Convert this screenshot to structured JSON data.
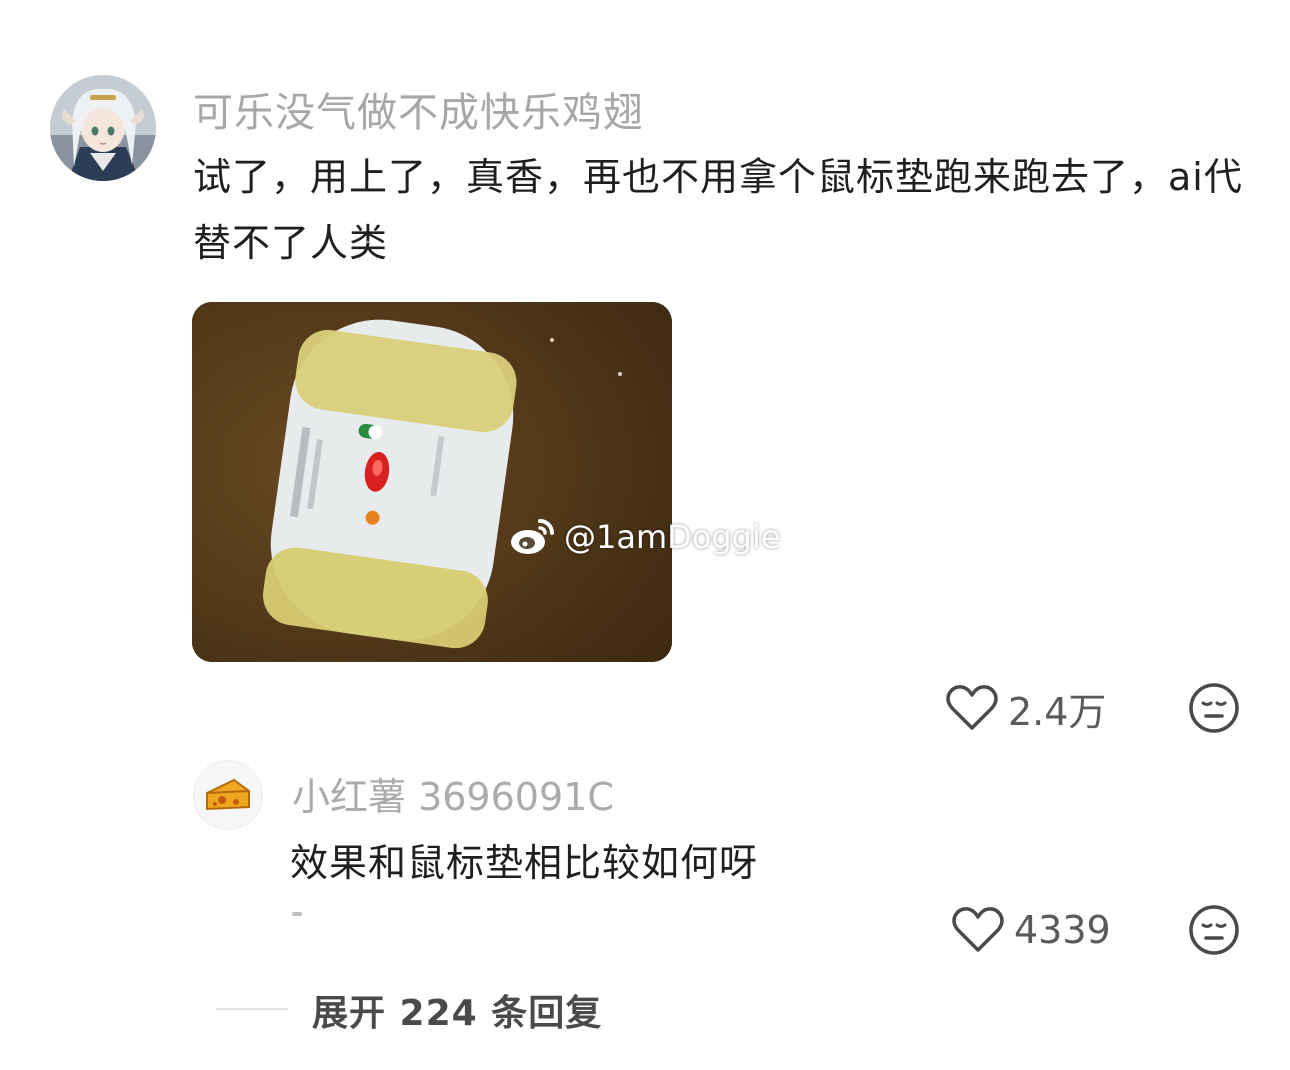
{
  "comment": {
    "username": "可乐没气做不成快乐鸡翅",
    "text": "试了，用上了，真香，再也不用拿个鼠标垫跑来跑去了，ai代替不了人类",
    "image_watermark": "@1amDoggie",
    "like_count": "2.4万",
    "icons": {
      "like": "heart-outline-icon",
      "dislike": "meh-face-icon",
      "watermark": "weibo-logo-icon"
    }
  },
  "reply": {
    "username": "小红薯 3696091C",
    "text": "效果和鼠标垫相比较如何呀",
    "like_count": "4339",
    "avatar_icon": "cheese-icon"
  },
  "expand": {
    "label": "展开 224 条回复"
  }
}
